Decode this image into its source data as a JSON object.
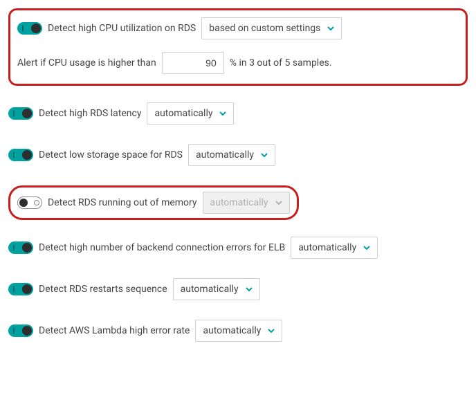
{
  "settings": [
    {
      "label": "Detect high CPU utilization on RDS",
      "mode": "based on custom settings",
      "enabled": true,
      "highlighted": true,
      "threshold": {
        "prefix": "Alert if CPU usage is higher than",
        "value": "90",
        "suffix": "% in 3 out of 5 samples."
      }
    },
    {
      "label": "Detect high RDS latency",
      "mode": "automatically",
      "enabled": true,
      "highlighted": false
    },
    {
      "label": "Detect low storage space for RDS",
      "mode": "automatically",
      "enabled": true,
      "highlighted": false
    },
    {
      "label": "Detect RDS running out of memory",
      "mode": "automatically",
      "enabled": false,
      "highlighted": true
    },
    {
      "label": "Detect high number of backend connection errors for ELB",
      "mode": "automatically",
      "enabled": true,
      "highlighted": false
    },
    {
      "label": "Detect RDS restarts sequence",
      "mode": "automatically",
      "enabled": true,
      "highlighted": false
    },
    {
      "label": "Detect AWS Lambda high error rate",
      "mode": "automatically",
      "enabled": true,
      "highlighted": false
    }
  ]
}
